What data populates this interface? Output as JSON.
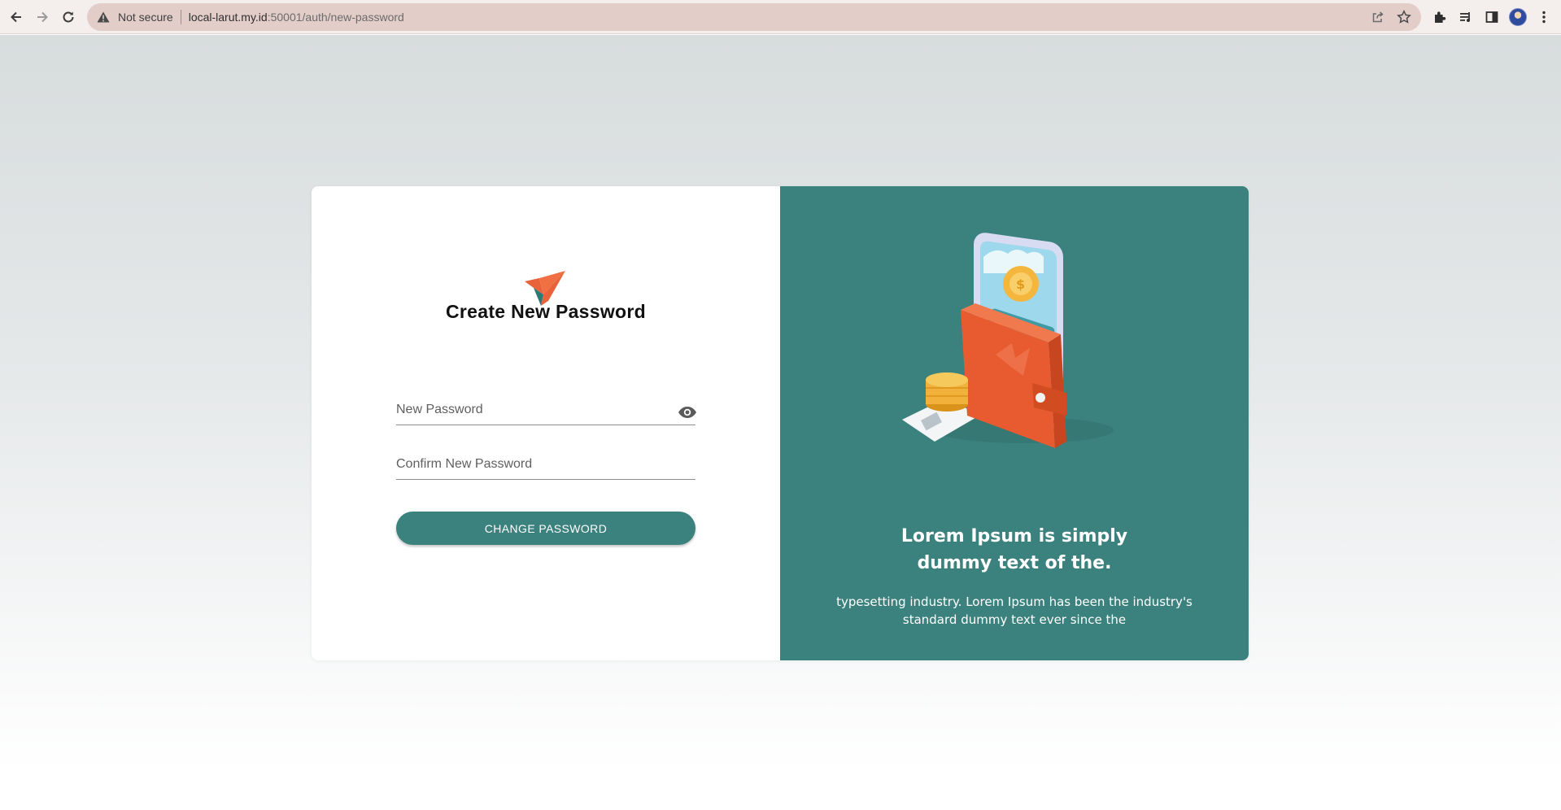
{
  "browser": {
    "security_label": "Not secure",
    "url_host": "local-larut.my.id",
    "url_path": ":50001/auth/new-password"
  },
  "form": {
    "title": "Create New Password",
    "new_password_placeholder": "New Password",
    "confirm_password_placeholder": "Confirm New Password",
    "submit_label": "CHANGE PASSWORD"
  },
  "promo": {
    "heading_line1": "Lorem Ipsum is simply",
    "heading_line2": "dummy text of the.",
    "body_line1": "typesetting industry. Lorem Ipsum has been the industry's",
    "body_line2": "standard dummy text ever since the"
  },
  "colors": {
    "accent": "#3b827e",
    "logo_orange": "#e8623a",
    "logo_dark": "#2c7a78"
  },
  "icons": [
    "back-icon",
    "forward-icon",
    "reload-icon",
    "warning-icon",
    "share-icon",
    "star-icon",
    "extensions-icon",
    "media-icon",
    "side-panel-icon",
    "profile-avatar",
    "menu-icon",
    "eye-icon"
  ]
}
